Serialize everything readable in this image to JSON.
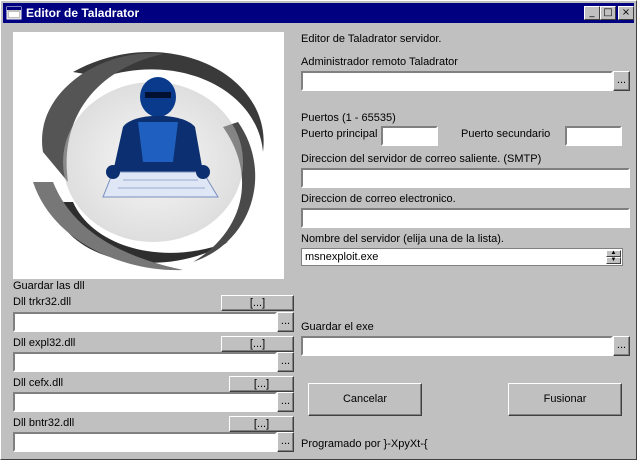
{
  "window": {
    "title": "Editor de Taladrator",
    "min_glyph": "_",
    "max_glyph": "□",
    "close_glyph": "×"
  },
  "left": {
    "guardar_dll_label": "Guardar las dll",
    "dlls": [
      {
        "label": "Dll trkr32.dll",
        "button": "[...]",
        "value": "",
        "browse": "..."
      },
      {
        "label": "Dll expl32.dll",
        "button": "[...]",
        "value": "",
        "browse": "..."
      },
      {
        "label": "Dll cefx.dll",
        "button": "[...]",
        "value": "",
        "browse": "..."
      },
      {
        "label": "Dll bntr32.dll",
        "button": "[...]",
        "value": "",
        "browse": "..."
      }
    ]
  },
  "right": {
    "header": "Editor de Taladrator servidor.",
    "admin_label": "Administrador remoto Taladrator",
    "admin_value": "",
    "admin_browse": "...",
    "ports_label": "Puertos (1 - 65535)",
    "port_main_label": "Puerto principal",
    "port_main_value": "",
    "port_secondary_label": "Puerto secundario",
    "port_secondary_value": "",
    "smtp_label": "Direccion del servidor de correo saliente. (SMTP)",
    "smtp_value": "",
    "email_label": "Direccion de correo electronico.",
    "email_value": "",
    "server_name_label": "Nombre del servidor (elija una de la lista).",
    "server_name_value": "msnexploit.exe",
    "save_exe_label": "Guardar el exe",
    "save_exe_value": "",
    "save_exe_browse": "...",
    "cancel_label": "Cancelar",
    "merge_label": "Fusionar",
    "footer": "Programado por }-XpyXt-{"
  },
  "colors": {
    "titlebar": "#000080",
    "face": "#c0c0c0"
  }
}
